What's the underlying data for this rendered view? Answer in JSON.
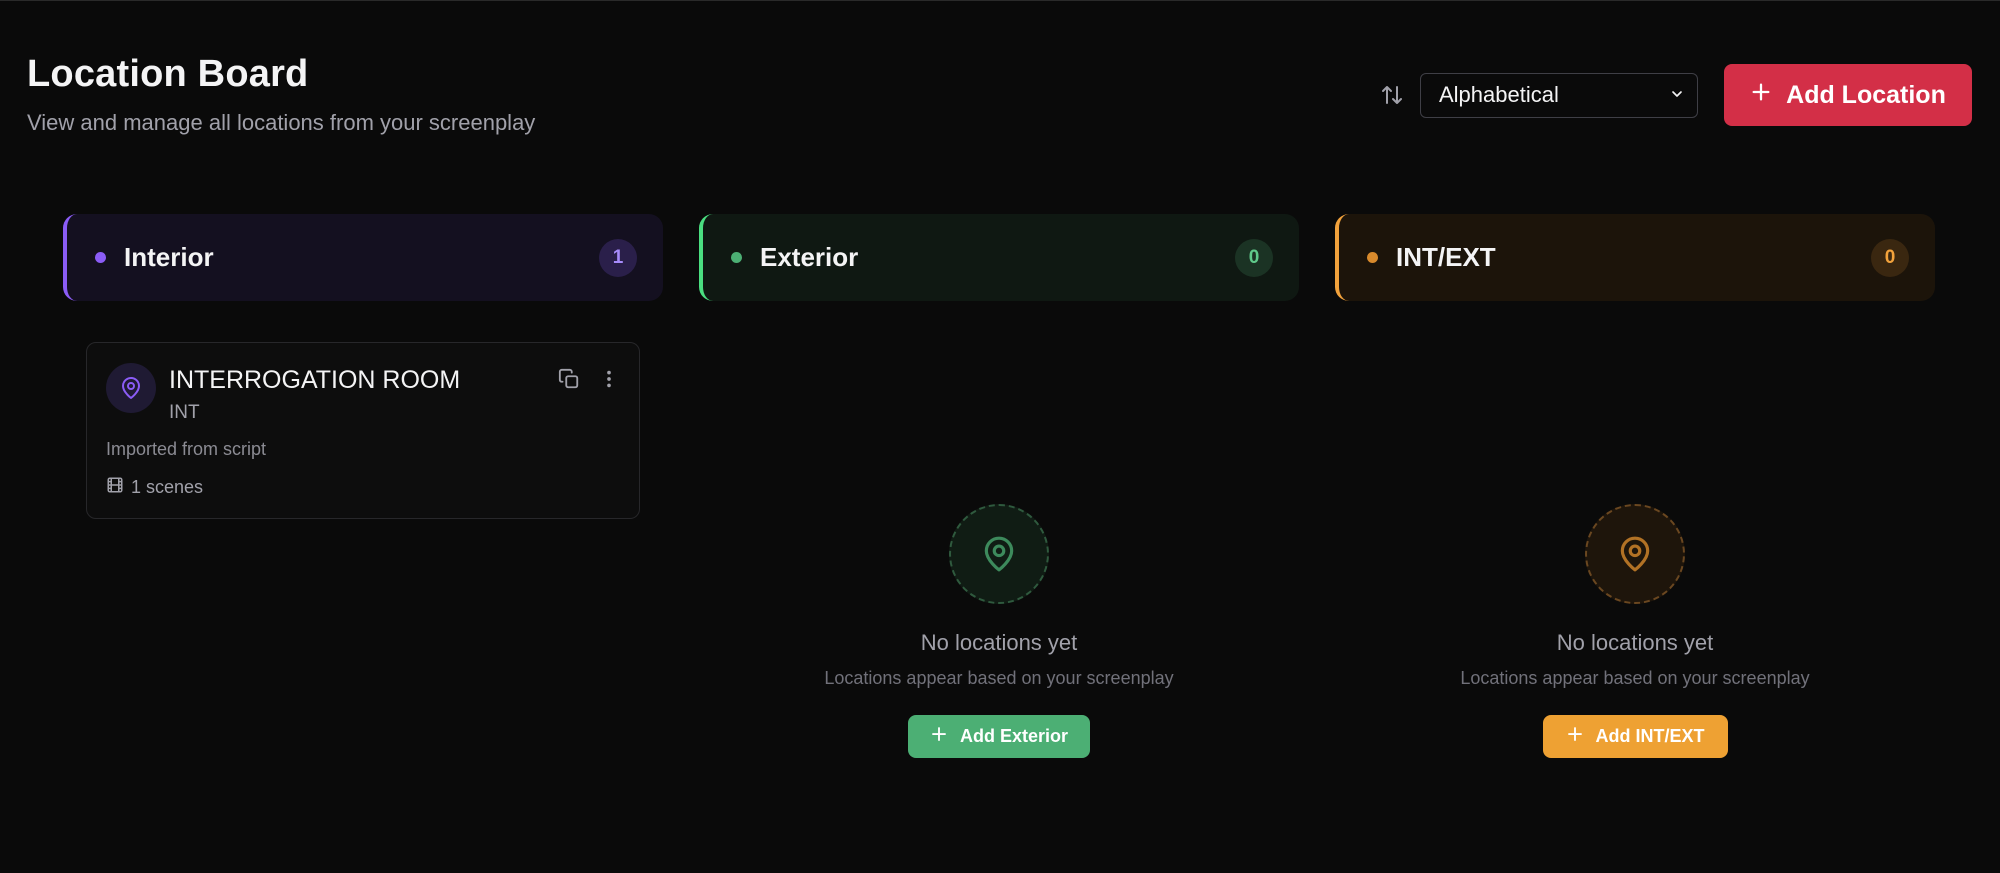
{
  "header": {
    "title": "Location Board",
    "subtitle": "View and manage all locations from your screenplay"
  },
  "controls": {
    "sort_icon": "arrows-up-down-icon",
    "sort_value": "Alphabetical",
    "add_location_label": "Add Location"
  },
  "columns": [
    {
      "title": "Interior",
      "count": "1",
      "accent": "#8b5cf6",
      "locations": [
        {
          "name": "INTERROGATION ROOM",
          "type": "INT",
          "description": "Imported from script",
          "scenes": "1 scenes"
        }
      ]
    },
    {
      "title": "Exterior",
      "count": "0",
      "accent": "#4caf74",
      "empty": {
        "title": "No locations yet",
        "subtitle": "Locations appear based on your screenplay",
        "button": "Add Exterior"
      }
    },
    {
      "title": "INT/EXT",
      "count": "0",
      "accent": "#f2a23c",
      "empty": {
        "title": "No locations yet",
        "subtitle": "Locations appear based on your screenplay",
        "button": "Add INT/EXT"
      }
    }
  ],
  "colors": {
    "background": "#0a0a0a",
    "primary_button": "#d32f47"
  }
}
